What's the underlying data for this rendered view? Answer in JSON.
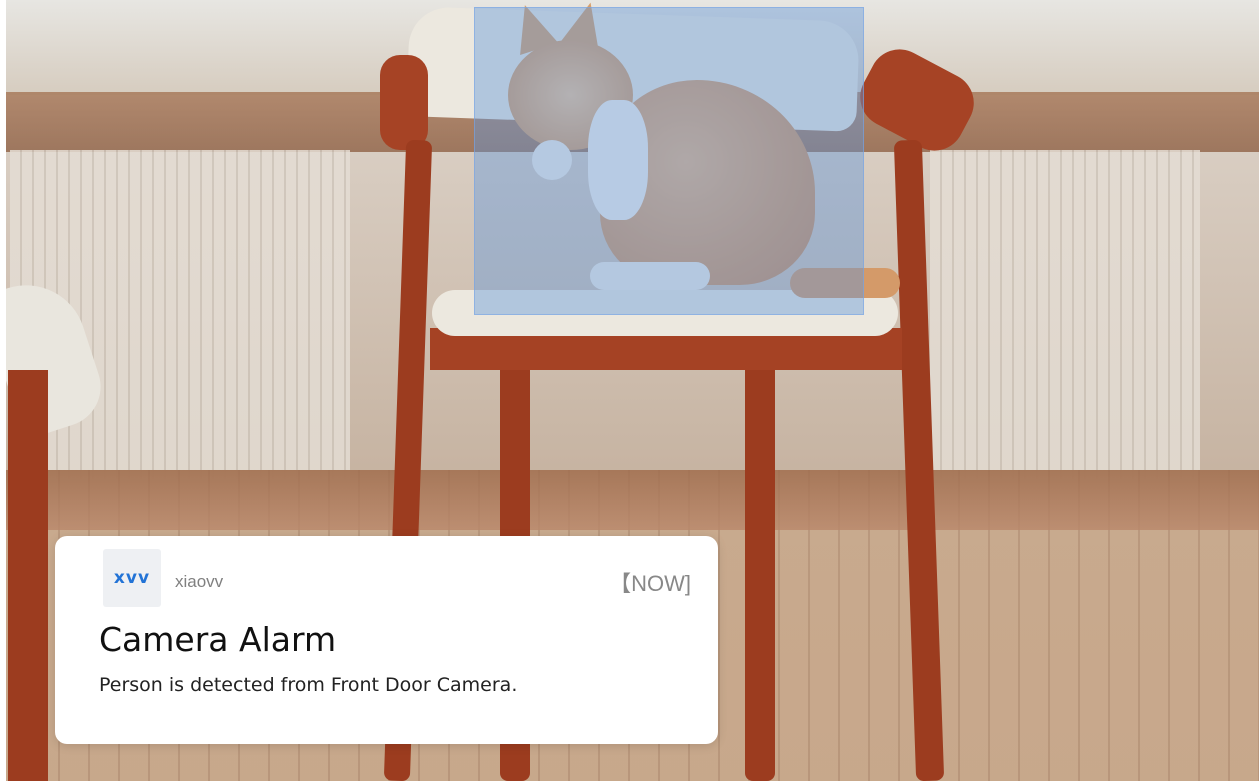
{
  "camera_view": {
    "detection_box_color": "#5f96dc"
  },
  "notification": {
    "app_logo_text": "xvv",
    "app_name": "xiaovv",
    "time": "【NOW]",
    "title": "Camera Alarm",
    "body": "Person is detected from Front Door Camera.",
    "accent_color": "#2273d6"
  }
}
